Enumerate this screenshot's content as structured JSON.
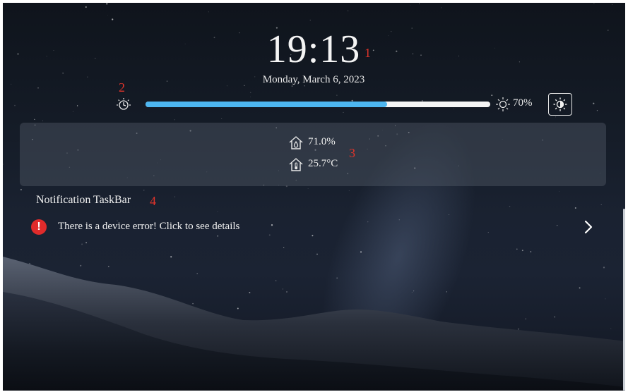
{
  "clock": {
    "time": "19:13",
    "date": "Monday, March 6, 2023"
  },
  "brightness": {
    "level_percent": 70,
    "value_label": "70%",
    "fill_color": "#4db6f0"
  },
  "sensors": {
    "humidity": "71.0%",
    "temperature": "25.7°C"
  },
  "notifications": {
    "title": "Notification TaskBar",
    "items": [
      {
        "text": "There is a device error! Click to see details",
        "status_color": "#e02b2b"
      }
    ]
  },
  "annotations": {
    "label_1": "1",
    "label_2": "2",
    "label_3": "3",
    "label_4": "4"
  },
  "icons": {
    "timer": "timer-icon",
    "sun": "sun-icon",
    "auto_brightness": "brightness-contrast-icon",
    "humidity": "home-humidity-icon",
    "temperature": "home-thermometer-icon",
    "error": "exclamation-icon",
    "chevron": "chevron-right-icon"
  }
}
